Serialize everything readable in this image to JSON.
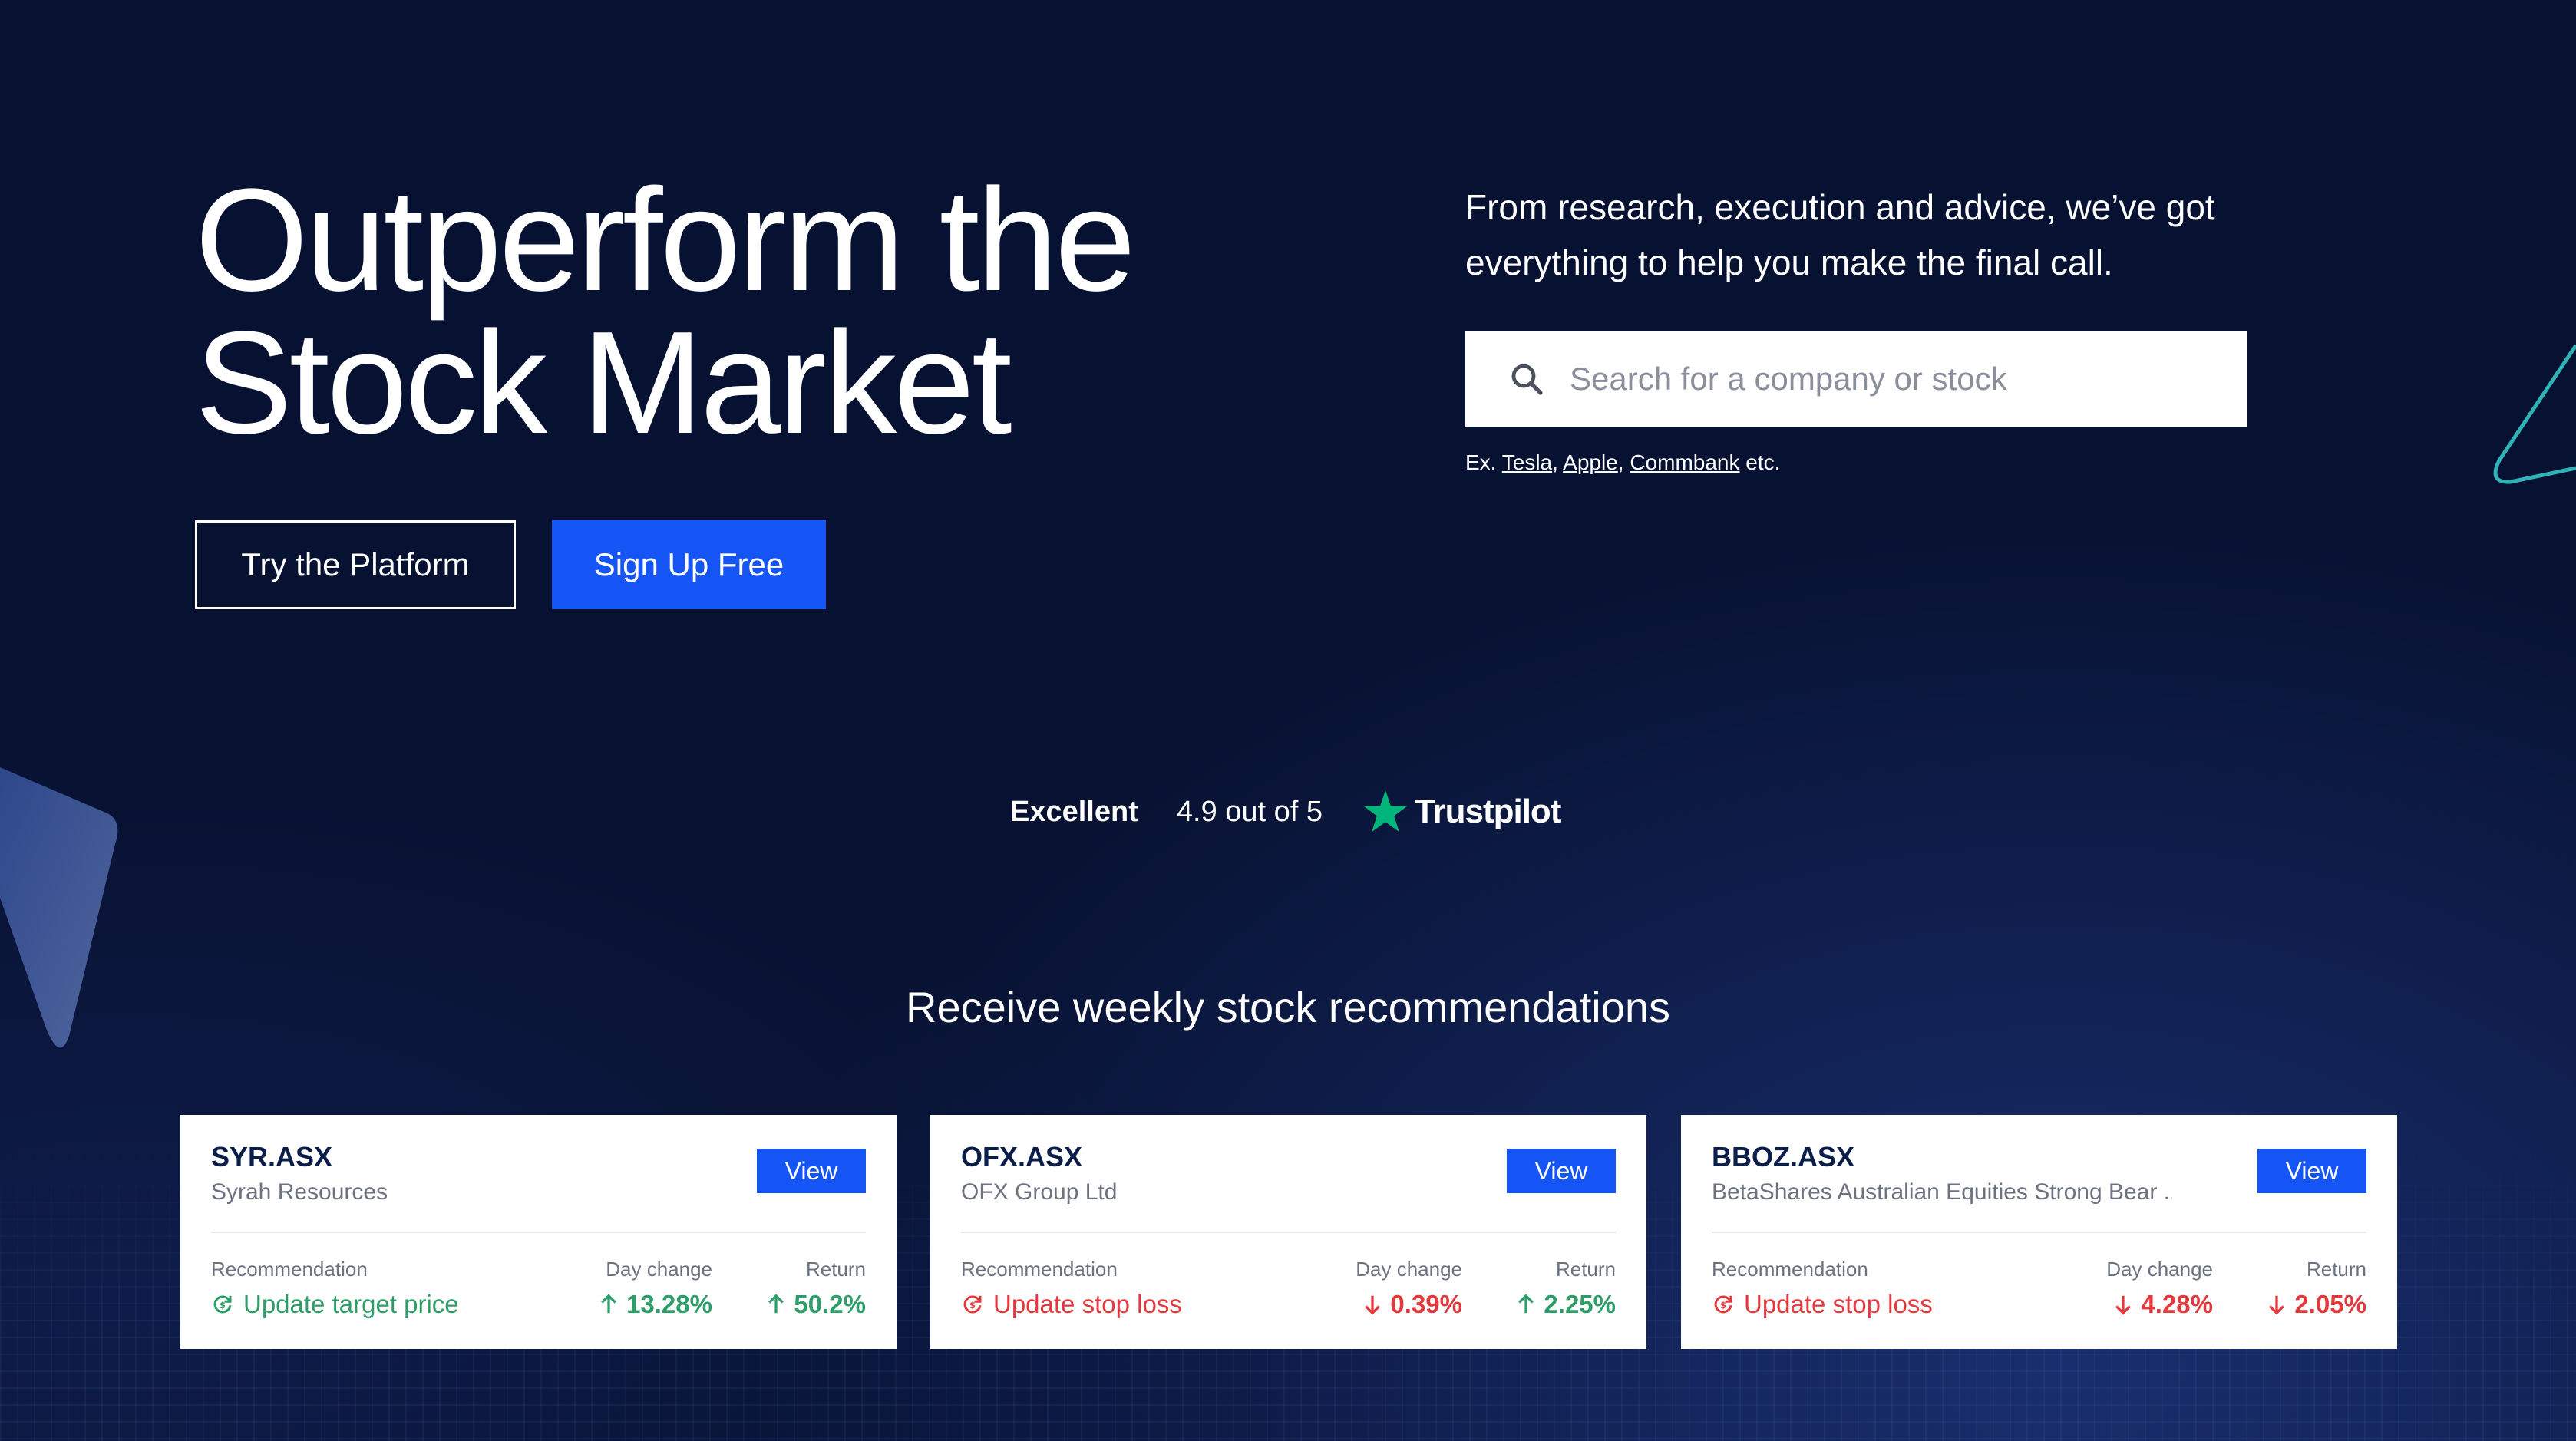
{
  "hero": {
    "title_line1": "Outperform the",
    "title_line2": "Stock Market",
    "try_button": "Try the Platform",
    "signup_button": "Sign Up Free",
    "tagline": "From research, execution and advice, we’ve got everything to help you make the final call."
  },
  "search": {
    "placeholder": "Search for a company or stock",
    "examples_prefix": "Ex.",
    "examples": [
      "Tesla",
      "Apple",
      "Commbank"
    ],
    "examples_suffix": "etc."
  },
  "trustpilot": {
    "label": "Excellent",
    "rating": "4.9 out of 5",
    "brand": "Trustpilot",
    "star_color": "#00b67a"
  },
  "recommendations": {
    "title": "Receive weekly stock recommendations",
    "labels": {
      "recommendation": "Recommendation",
      "day_change": "Day change",
      "return": "Return"
    },
    "cards": [
      {
        "ticker": "SYR.ASX",
        "company": "Syrah Resources",
        "view": "View",
        "recommendation": "Update target price",
        "day_change": "13.28%",
        "day_direction": "up",
        "return": "50.2%",
        "return_direction": "up"
      },
      {
        "ticker": "OFX.ASX",
        "company": "OFX Group Ltd",
        "view": "View",
        "recommendation": "Update stop loss",
        "day_change": "0.39%",
        "day_direction": "down",
        "return": "2.25%",
        "return_direction": "up"
      },
      {
        "ticker": "BBOZ.ASX",
        "company": "BetaShares Australian Equities Strong Bear ....",
        "view": "View",
        "recommendation": "Update stop loss",
        "day_change": "4.28%",
        "day_direction": "down",
        "return": "2.05%",
        "return_direction": "down"
      }
    ]
  },
  "colors": {
    "background": "#071131",
    "primary": "#1554f5",
    "positive": "#2e9e68",
    "negative": "#e3383c"
  }
}
